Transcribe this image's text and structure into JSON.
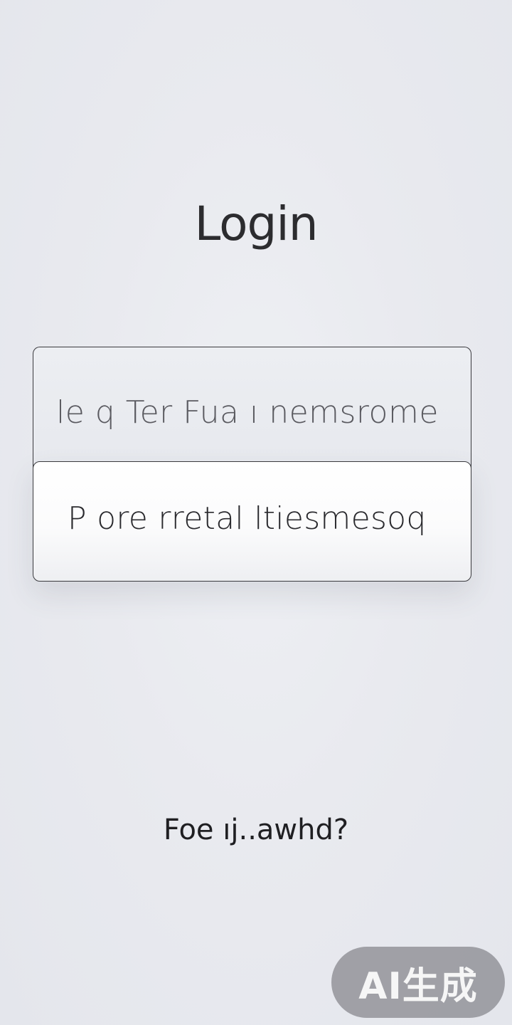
{
  "header": {
    "title": "Login"
  },
  "form": {
    "username_placeholder": "le q Ter Fua ı nemsrome",
    "password_placeholder": "P ore rretal ltiesmesoq"
  },
  "links": {
    "forgot_password": "Foe ıj..awhd?"
  },
  "watermark": {
    "label": "AI生成"
  },
  "colors": {
    "background": "#e9eaef",
    "field_border": "#3a3a3e",
    "text": "#2c2c2f",
    "watermark_bg": "#8c8c92"
  }
}
